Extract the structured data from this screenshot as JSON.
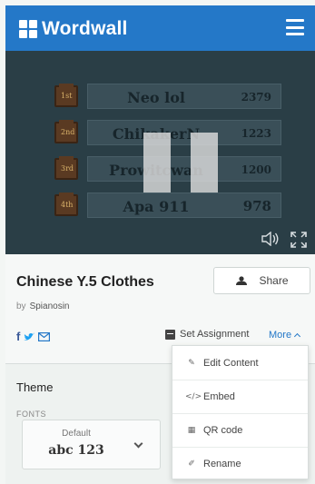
{
  "header": {
    "app_name": "Wordwall"
  },
  "leaderboard": [
    {
      "rank": "1st",
      "name": "Neo lol",
      "score": "2379"
    },
    {
      "rank": "2nd",
      "name": "ChikakerN",
      "score": "1223"
    },
    {
      "rank": "3rd",
      "name": "Prowitcwan",
      "score": "1200"
    },
    {
      "rank": "4th",
      "name": "Apa 911",
      "score": "978"
    }
  ],
  "activity": {
    "title": "Chinese Y.5 Clothes",
    "by_label": "by",
    "author": "Spianosin",
    "share_label": "Share",
    "social": {
      "facebook": "f"
    },
    "set_assignment_label": "Set Assignment",
    "more_label": "More"
  },
  "theme": {
    "title": "Theme",
    "fonts_label": "FONTS",
    "font_name": "Default",
    "font_sample": "abc 123"
  },
  "more_menu": [
    {
      "icon": "✎",
      "label": "Edit Content"
    },
    {
      "icon": "</>",
      "label": "Embed"
    },
    {
      "icon": "▦",
      "label": "QR code"
    },
    {
      "icon": "✐",
      "label": "Rename"
    }
  ],
  "colors": {
    "brand": "#2478c8",
    "game_bg": "#2a3e46"
  }
}
